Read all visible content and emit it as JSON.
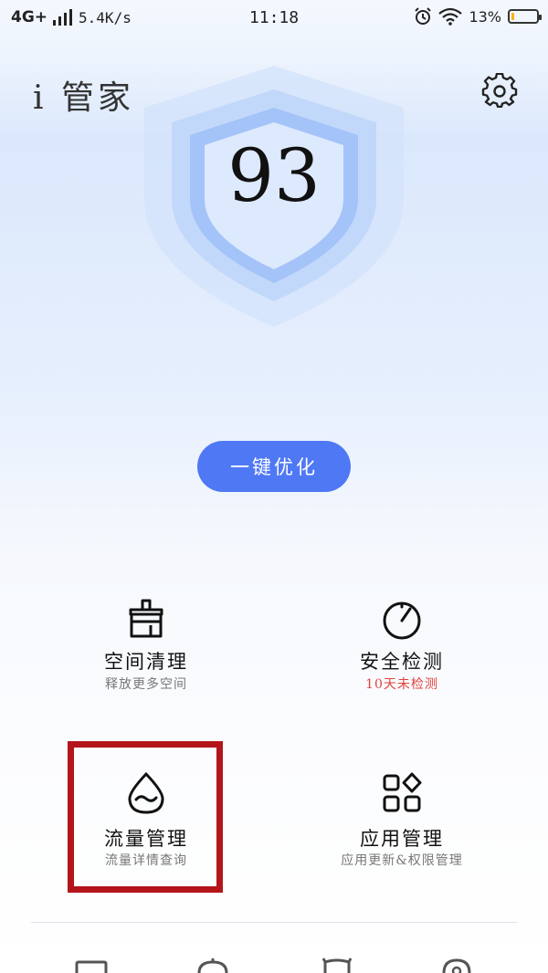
{
  "status_bar": {
    "network": "4G+",
    "speed": "5.4K/s",
    "time": "11:18",
    "battery_percent": "13%",
    "battery_level": 0.13
  },
  "header": {
    "title": "i 管家"
  },
  "score": {
    "value": "93"
  },
  "optimize_button": {
    "label": "一键优化"
  },
  "tiles": [
    {
      "title": "空间清理",
      "subtitle": "释放更多空间",
      "icon": "broom-icon"
    },
    {
      "title": "安全检测",
      "subtitle": "10天未检测",
      "icon": "gauge-icon"
    },
    {
      "title": "流量管理",
      "subtitle": "流量详情查询",
      "icon": "water-drop-icon"
    },
    {
      "title": "应用管理",
      "subtitle": "应用更新&权限管理",
      "icon": "apps-grid-icon"
    }
  ],
  "colors": {
    "accent": "#4f78f5",
    "warning": "#e0433e",
    "highlight_box": "#b3151b"
  }
}
